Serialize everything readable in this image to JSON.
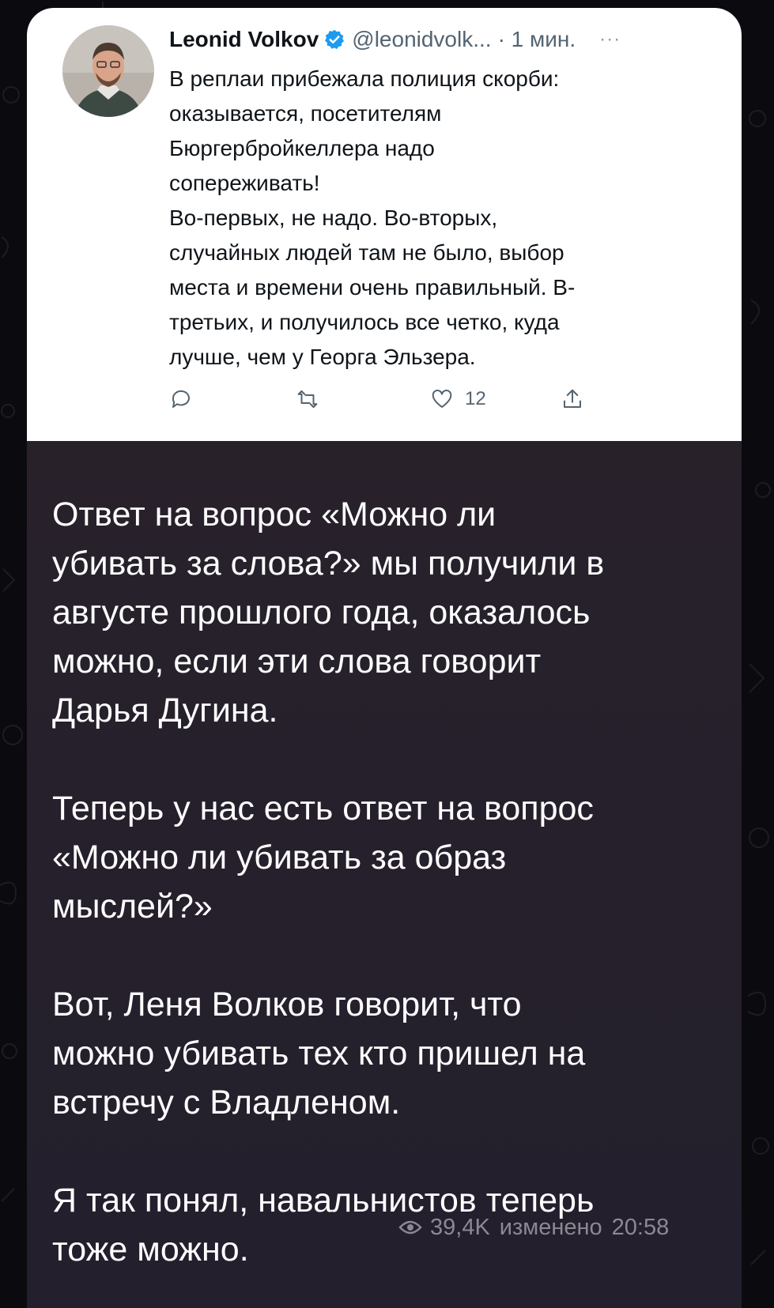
{
  "tweet": {
    "author_name": "Leonid Volkov",
    "handle": "@leonidvolk...",
    "time_ago": "· 1 мин.",
    "more": "···",
    "text_lines": [
      "В реплаи прибежала полиция скорби:",
      "оказывается, посетителям",
      "Бюргербройкеллера надо",
      "сопереживать!",
      "Во-первых, не надо. Во-вторых,",
      "случайных людей там не было, выбор",
      "места и времени очень правильный. В-",
      "третьих, и получилось все четко, куда",
      "лучше, чем у Георга Эльзера."
    ],
    "like_count": "12",
    "accent_color": "#1d9bf0"
  },
  "post": {
    "paragraphs": [
      {
        "lines": [
          "Ответ на вопрос «Можно ли",
          "убивать за слова?» мы получили в",
          "августе прошлого года, оказалось",
          "можно, если эти слова говорит",
          "Дарья Дугина."
        ]
      },
      {
        "lines": [
          "Теперь у нас есть ответ на вопрос",
          "«Можно ли убивать за образ",
          "мыслей?»"
        ]
      },
      {
        "lines": [
          "Вот, Леня Волков говорит, что",
          "можно убивать тех кто пришел на",
          "встречу с Владленом."
        ]
      },
      {
        "lines": [
          "Я так понял, навальнистов теперь",
          "тоже можно."
        ]
      }
    ],
    "views": "39,4K",
    "edited_label": "изменено",
    "time": "20:58"
  }
}
